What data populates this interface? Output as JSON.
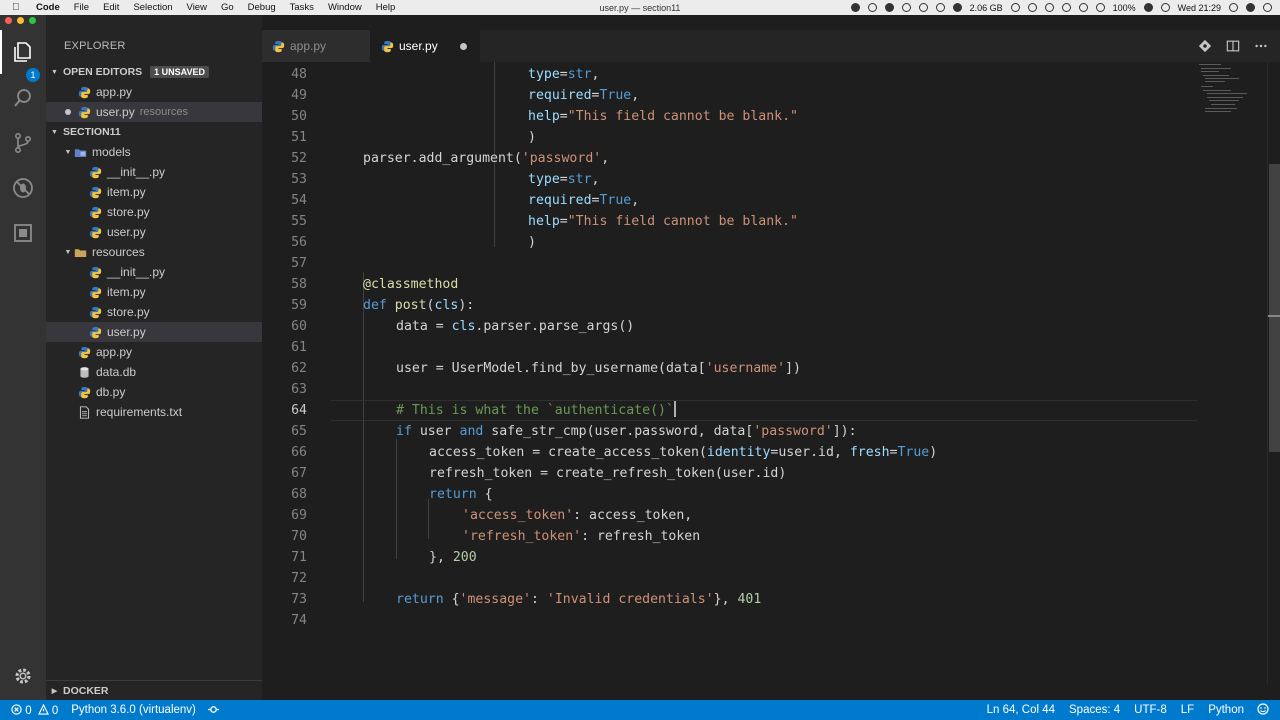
{
  "menubar": {
    "app_name": "Code",
    "items": [
      "File",
      "Edit",
      "Selection",
      "View",
      "Go",
      "Debug",
      "Tasks",
      "Window",
      "Help"
    ],
    "window_title": "user.py — section11",
    "memory": "2.06 GB",
    "battery": "100%",
    "clock": "Wed 21:29"
  },
  "sidebar": {
    "title": "EXPLORER",
    "open_editors": {
      "label": "OPEN EDITORS",
      "badge": "1 UNSAVED",
      "items": [
        {
          "name": "app.py",
          "desc": ""
        },
        {
          "name": "user.py",
          "desc": "resources"
        }
      ]
    },
    "project": {
      "label": "SECTION11",
      "tree": [
        {
          "name": "models",
          "type": "folder"
        },
        {
          "name": "__init__.py",
          "type": "file"
        },
        {
          "name": "item.py",
          "type": "file"
        },
        {
          "name": "store.py",
          "type": "file"
        },
        {
          "name": "user.py",
          "type": "file"
        },
        {
          "name": "resources",
          "type": "folder"
        },
        {
          "name": "__init__.py",
          "type": "file"
        },
        {
          "name": "item.py",
          "type": "file"
        },
        {
          "name": "store.py",
          "type": "file"
        },
        {
          "name": "user.py",
          "type": "file"
        },
        {
          "name": "app.py",
          "type": "file"
        },
        {
          "name": "data.db",
          "type": "file"
        },
        {
          "name": "db.py",
          "type": "file"
        },
        {
          "name": "requirements.txt",
          "type": "file"
        }
      ]
    },
    "docker": "DOCKER",
    "notification_count": "1"
  },
  "tabs": [
    {
      "label": "app.py"
    },
    {
      "label": "user.py"
    }
  ],
  "editor": {
    "line_numbers": [
      "48",
      "49",
      "50",
      "51",
      "52",
      "53",
      "54",
      "55",
      "56",
      "57",
      "58",
      "59",
      "60",
      "61",
      "62",
      "63",
      "64",
      "65",
      "66",
      "67",
      "68",
      "69",
      "70",
      "71",
      "72",
      "73",
      "74"
    ]
  },
  "status": {
    "errors": "0",
    "warnings": "0",
    "interpreter": "Python 3.6.0 (virtualenv)",
    "position": "Ln 64, Col 44",
    "spaces": "Spaces: 4",
    "encoding": "UTF-8",
    "eol": "LF",
    "language": "Python"
  }
}
